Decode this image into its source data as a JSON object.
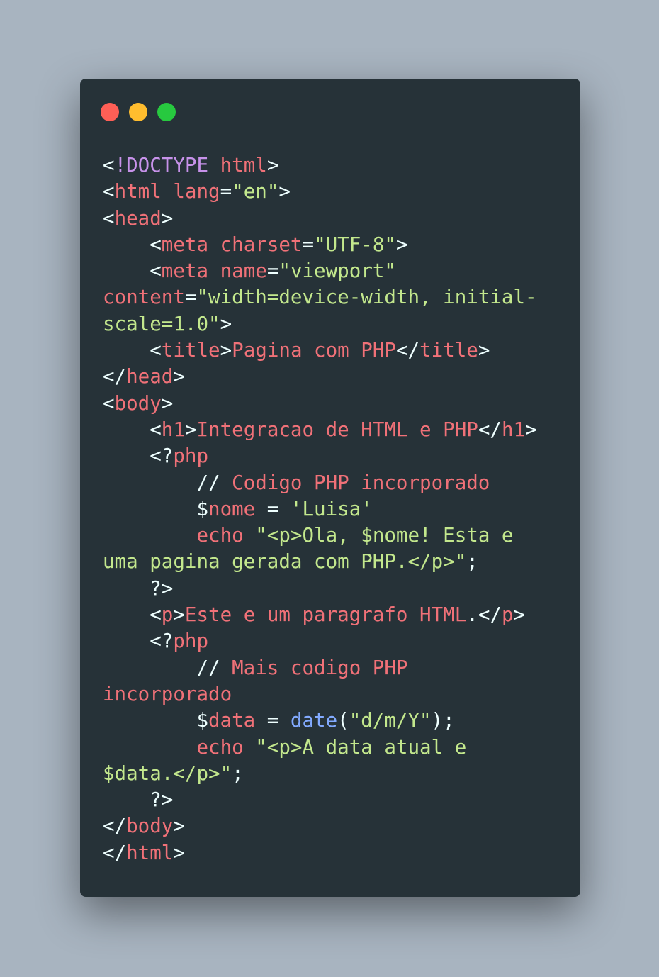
{
  "window": {
    "controls": [
      {
        "icon": "close-dot-icon",
        "color": "#ff5f56"
      },
      {
        "icon": "minimize-dot-icon",
        "color": "#ffbd2e"
      },
      {
        "icon": "maximize-dot-icon",
        "color": "#27c93f"
      }
    ]
  },
  "colors": {
    "background": "#a8b4c0",
    "editor": "#263238",
    "punctuation": "#eeffff",
    "tag": "#f07178",
    "doctype": "#c792ea",
    "string": "#c3e88d",
    "function": "#82aaff"
  },
  "code": {
    "lines": [
      [
        [
          "p",
          "<"
        ],
        [
          "doc",
          "!DOCTYPE"
        ],
        [
          "p",
          " "
        ],
        [
          "tag",
          "html"
        ],
        [
          "p",
          ">"
        ]
      ],
      [
        [
          "p",
          "<"
        ],
        [
          "tag",
          "html"
        ],
        [
          "p",
          " "
        ],
        [
          "tag",
          "lang"
        ],
        [
          "p",
          "="
        ],
        [
          "str",
          "\"en\""
        ],
        [
          "p",
          ">"
        ]
      ],
      [
        [
          "p",
          "<"
        ],
        [
          "tag",
          "head"
        ],
        [
          "p",
          ">"
        ]
      ],
      [
        [
          "p",
          "    <"
        ],
        [
          "tag",
          "meta"
        ],
        [
          "p",
          " "
        ],
        [
          "tag",
          "charset"
        ],
        [
          "p",
          "="
        ],
        [
          "str",
          "\"UTF-8\""
        ],
        [
          "p",
          ">"
        ]
      ],
      [
        [
          "p",
          "    <"
        ],
        [
          "tag",
          "meta"
        ],
        [
          "p",
          " "
        ],
        [
          "tag",
          "name"
        ],
        [
          "p",
          "="
        ],
        [
          "str",
          "\"viewport\""
        ]
      ],
      [
        [
          "tag",
          "content"
        ],
        [
          "p",
          "="
        ],
        [
          "str",
          "\"width=device-width, initial-"
        ]
      ],
      [
        [
          "str",
          "scale=1.0\""
        ],
        [
          "p",
          ">"
        ]
      ],
      [
        [
          "p",
          "    <"
        ],
        [
          "tag",
          "title"
        ],
        [
          "p",
          ">"
        ],
        [
          "tag",
          "Pagina com PHP"
        ],
        [
          "p",
          "</"
        ],
        [
          "tag",
          "title"
        ],
        [
          "p",
          ">"
        ]
      ],
      [
        [
          "p",
          "</"
        ],
        [
          "tag",
          "head"
        ],
        [
          "p",
          ">"
        ]
      ],
      [
        [
          "p",
          "<"
        ],
        [
          "tag",
          "body"
        ],
        [
          "p",
          ">"
        ]
      ],
      [
        [
          "p",
          "    <"
        ],
        [
          "tag",
          "h1"
        ],
        [
          "p",
          ">"
        ],
        [
          "tag",
          "Integracao de HTML e PHP"
        ],
        [
          "p",
          "</"
        ],
        [
          "tag",
          "h1"
        ],
        [
          "p",
          ">"
        ]
      ],
      [
        [
          "p",
          "    <?"
        ],
        [
          "tag",
          "php"
        ]
      ],
      [
        [
          "p",
          "        // "
        ],
        [
          "tag",
          "Codigo PHP incorporado"
        ]
      ],
      [
        [
          "p",
          "        $"
        ],
        [
          "tag",
          "nome"
        ],
        [
          "p",
          " = "
        ],
        [
          "str",
          "'Luisa'"
        ]
      ],
      [
        [
          "p",
          "        "
        ],
        [
          "tag",
          "echo"
        ],
        [
          "p",
          " "
        ],
        [
          "str",
          "\"<p>Ola, $nome! Esta e"
        ]
      ],
      [
        [
          "str",
          "uma pagina gerada com PHP.</p>\""
        ],
        [
          "p",
          ";"
        ]
      ],
      [
        [
          "p",
          "    ?>"
        ]
      ],
      [
        [
          "p",
          "    <"
        ],
        [
          "tag",
          "p"
        ],
        [
          "p",
          ">"
        ],
        [
          "tag",
          "Este e um paragrafo HTML"
        ],
        [
          "p",
          ".</"
        ],
        [
          "tag",
          "p"
        ],
        [
          "p",
          ">"
        ]
      ],
      [
        [
          "p",
          "    <?"
        ],
        [
          "tag",
          "php"
        ]
      ],
      [
        [
          "p",
          "        // "
        ],
        [
          "tag",
          "Mais codigo PHP"
        ]
      ],
      [
        [
          "tag",
          "incorporado"
        ]
      ],
      [
        [
          "p",
          "        $"
        ],
        [
          "tag",
          "data"
        ],
        [
          "p",
          " = "
        ],
        [
          "fn",
          "date"
        ],
        [
          "p",
          "("
        ],
        [
          "str",
          "\"d/m/Y\""
        ],
        [
          "p",
          ");"
        ]
      ],
      [
        [
          "p",
          "        "
        ],
        [
          "tag",
          "echo"
        ],
        [
          "p",
          " "
        ],
        [
          "str",
          "\"<p>A data atual e"
        ]
      ],
      [
        [
          "str",
          "$data.</p>\""
        ],
        [
          "p",
          ";"
        ]
      ],
      [
        [
          "p",
          "    ?>"
        ]
      ],
      [
        [
          "p",
          "</"
        ],
        [
          "tag",
          "body"
        ],
        [
          "p",
          ">"
        ]
      ],
      [
        [
          "p",
          "</"
        ],
        [
          "tag",
          "html"
        ],
        [
          "p",
          ">"
        ]
      ]
    ]
  }
}
